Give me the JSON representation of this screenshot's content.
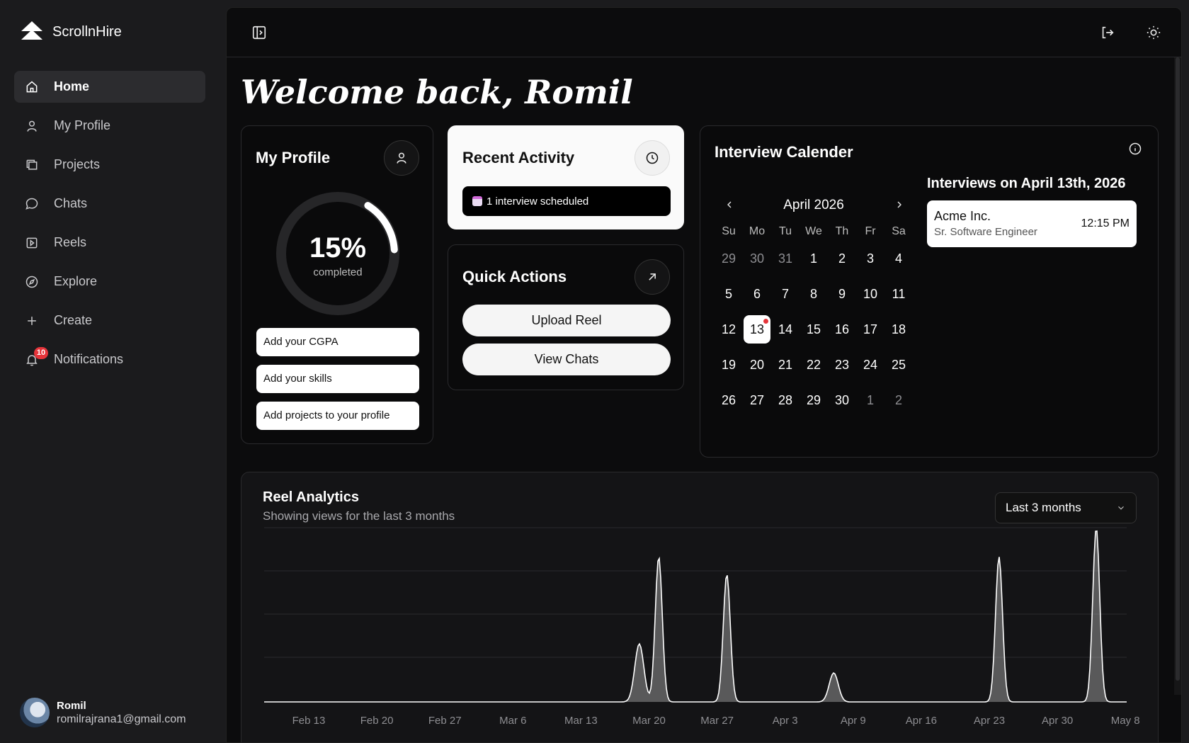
{
  "app": {
    "name": "ScrollnHire"
  },
  "sidebar": {
    "items": [
      {
        "label": "Home",
        "icon": "home-icon",
        "active": true
      },
      {
        "label": "My Profile",
        "icon": "user-icon"
      },
      {
        "label": "Projects",
        "icon": "folders-icon"
      },
      {
        "label": "Chats",
        "icon": "chat-icon"
      },
      {
        "label": "Reels",
        "icon": "play-icon"
      },
      {
        "label": "Explore",
        "icon": "compass-icon"
      },
      {
        "label": "Create",
        "icon": "plus-icon"
      },
      {
        "label": "Notifications",
        "icon": "bell-icon",
        "badge": "10"
      }
    ],
    "user": {
      "name": "Romil",
      "email": "romilrajrana1@gmail.com"
    }
  },
  "header": {
    "welcome": "Welcome back, Romil"
  },
  "profile_card": {
    "title": "My Profile",
    "progress_percent": 15,
    "progress_label": "15%",
    "progress_sub": "completed",
    "tasks": [
      "Add your CGPA",
      "Add your skills",
      "Add projects to your profile"
    ]
  },
  "activity": {
    "title": "Recent Activity",
    "item": "1 interview scheduled"
  },
  "quick_actions": {
    "title": "Quick Actions",
    "buttons": [
      "Upload Reel",
      "View Chats"
    ]
  },
  "calendar": {
    "title": "Interview Calender",
    "month": "April 2026",
    "weekdays": [
      "Su",
      "Mo",
      "Tu",
      "We",
      "Th",
      "Fr",
      "Sa"
    ],
    "weeks": [
      [
        "29",
        "30",
        "31",
        "1",
        "2",
        "3",
        "4"
      ],
      [
        "5",
        "6",
        "7",
        "8",
        "9",
        "10",
        "11"
      ],
      [
        "12",
        "13",
        "14",
        "15",
        "16",
        "17",
        "18"
      ],
      [
        "19",
        "20",
        "21",
        "22",
        "23",
        "24",
        "25"
      ],
      [
        "26",
        "27",
        "28",
        "29",
        "30",
        "1",
        "2"
      ]
    ],
    "selected": "13",
    "interviews_title": "Interviews on April 13th, 2026",
    "interview": {
      "company": "Acme Inc.",
      "role": "Sr. Software Engineer",
      "time": "12:15 PM"
    }
  },
  "analytics": {
    "title": "Reel Analytics",
    "subtitle": "Showing views for the last 3 months",
    "range": "Last 3 months"
  },
  "chart_data": {
    "type": "area",
    "title": "Reel Analytics",
    "x_ticks": [
      "Feb 13",
      "Feb 20",
      "Feb 27",
      "Mar 6",
      "Mar 13",
      "Mar 20",
      "Mar 27",
      "Apr 3",
      "Apr 9",
      "Apr 16",
      "Apr 23",
      "Apr 30",
      "May 8"
    ],
    "peaks": [
      {
        "x": "Mar 19",
        "value": 0.4
      },
      {
        "x": "Mar 21",
        "value": 1.0
      },
      {
        "x": "Mar 28",
        "value": 0.88
      },
      {
        "x": "Apr 8",
        "value": 0.2
      },
      {
        "x": "Apr 25",
        "value": 1.0
      },
      {
        "x": "May 5",
        "value": 1.2
      }
    ],
    "grid": true,
    "colors": {
      "line": "#ffffff",
      "fill": "#d9d9d9"
    }
  }
}
